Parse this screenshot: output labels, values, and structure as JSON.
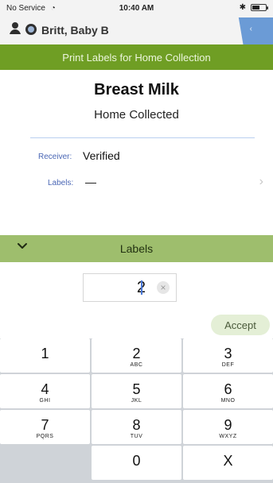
{
  "status_bar": {
    "carrier": "No Service",
    "time": "10:40 AM",
    "battery_level": 0.55
  },
  "patient": {
    "name": "Britt, Baby B"
  },
  "header": {
    "title": "Print Labels for Home Collection"
  },
  "item": {
    "title": "Breast Milk",
    "subtitle": "Home Collected",
    "receiver_label": "Receiver:",
    "receiver_value": "Verified",
    "labels_label": "Labels:",
    "labels_value": "—"
  },
  "labels_section": {
    "title": "Labels",
    "value": "2",
    "accept_label": "Accept"
  },
  "keypad": {
    "keys": [
      {
        "num": "1",
        "letters": ""
      },
      {
        "num": "2",
        "letters": "ABC"
      },
      {
        "num": "3",
        "letters": "DEF"
      },
      {
        "num": "4",
        "letters": "GHI"
      },
      {
        "num": "5",
        "letters": "JKL"
      },
      {
        "num": "6",
        "letters": "MNO"
      },
      {
        "num": "7",
        "letters": "PQRS"
      },
      {
        "num": "8",
        "letters": "TUV"
      },
      {
        "num": "9",
        "letters": "WXYZ"
      },
      {
        "num": "",
        "letters": ""
      },
      {
        "num": "0",
        "letters": ""
      },
      {
        "num": "X",
        "letters": ""
      }
    ]
  }
}
